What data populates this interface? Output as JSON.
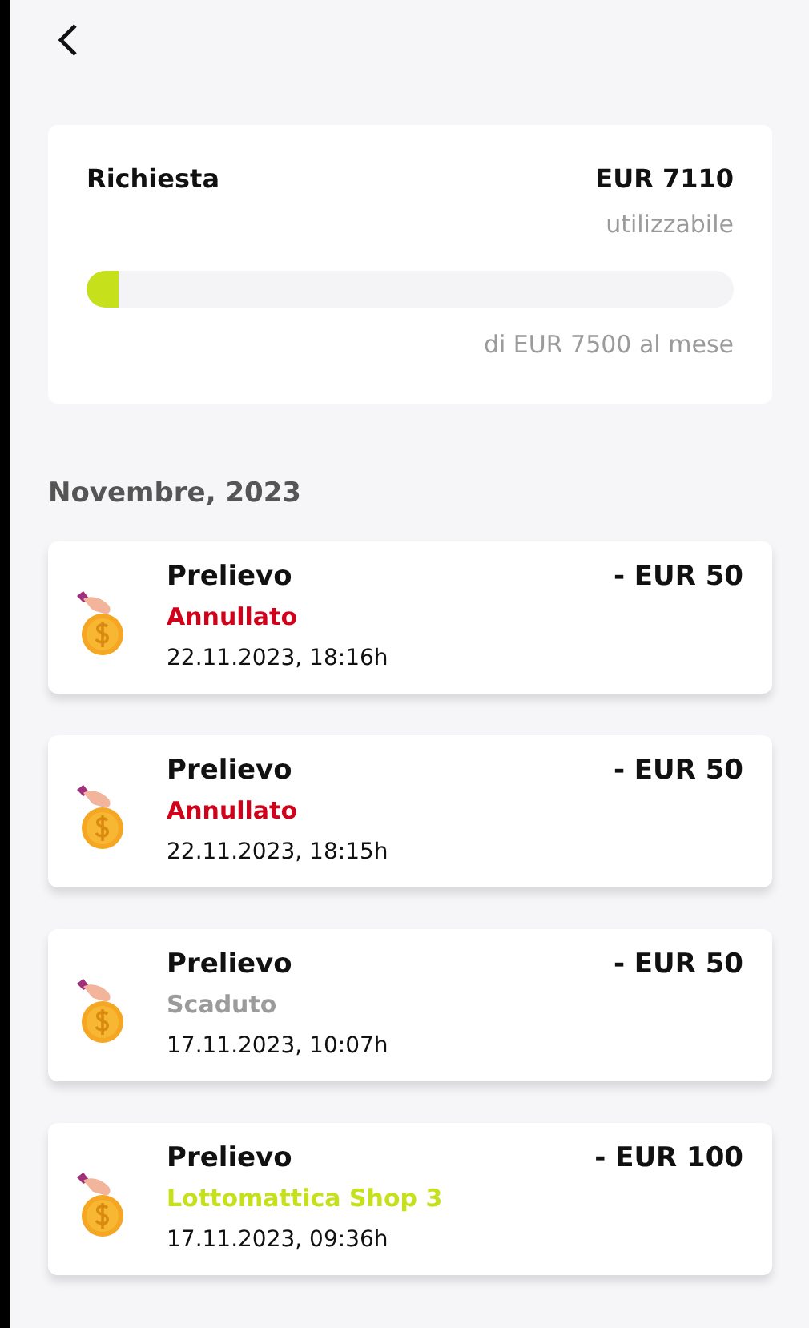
{
  "summary": {
    "title": "Richiesta",
    "amount": "EUR 7110",
    "amount_note": "utilizzabile",
    "level": 0.05,
    "limit": "di EUR 7500 al mese"
  },
  "section": "Novembre, 2023",
  "transactions": [
    {
      "title": "Prelievo",
      "amount": "- EUR 50",
      "status": "Annullato",
      "color": "#d0021b",
      "date": "22.11.2023, 18:16h"
    },
    {
      "title": "Prelievo",
      "amount": "- EUR 50",
      "status": "Annullato",
      "color": "#d0021b",
      "date": "22.11.2023, 18:15h"
    },
    {
      "title": "Prelievo",
      "amount": "- EUR 50",
      "status": "Scaduto",
      "color": "#9b9b9b",
      "date": "17.11.2023, 10:07h"
    },
    {
      "title": "Prelievo",
      "amount": "- EUR 100",
      "status": "Lottomattica Shop 3",
      "color": "#c6e01c",
      "date": "17.11.2023, 09:36h"
    }
  ]
}
